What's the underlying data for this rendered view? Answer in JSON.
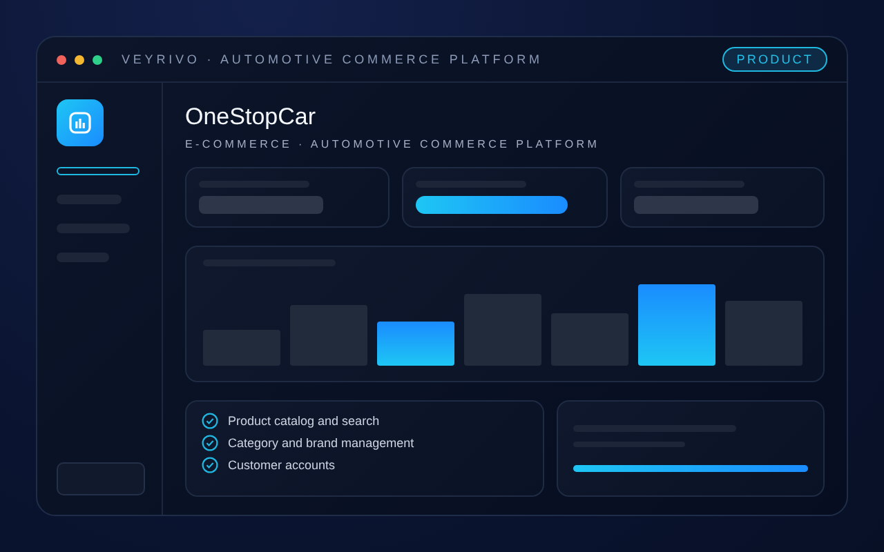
{
  "window": {
    "title": "VEYRIVO · AUTOMOTIVE COMMERCE PLATFORM",
    "badge": "PRODUCT"
  },
  "header": {
    "title": "OneStopCar",
    "subtitle": "E-COMMERCE · AUTOMOTIVE COMMERCE PLATFORM"
  },
  "features": [
    "Product catalog and search",
    "Category and brand management",
    "Customer accounts"
  ],
  "sidebar": {
    "items": [
      {
        "selected": true
      },
      {
        "selected": false
      },
      {
        "selected": false
      },
      {
        "selected": false
      }
    ]
  },
  "progress": {
    "level": 1
  }
}
